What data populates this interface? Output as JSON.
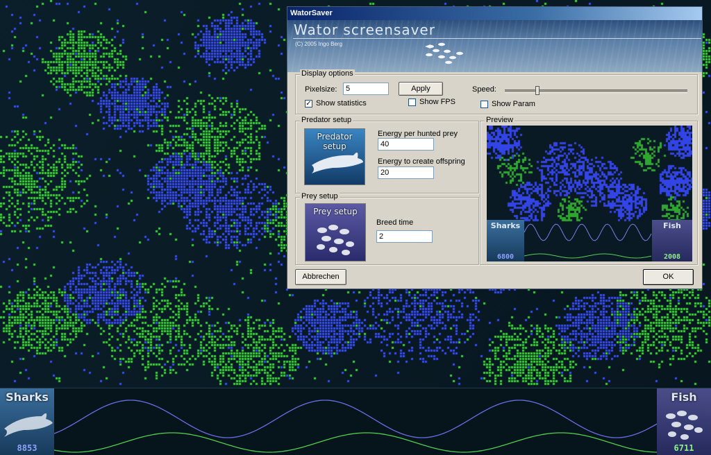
{
  "dialog": {
    "title": "WatorSaver",
    "banner_title": "Wator screensaver",
    "copyright": "(C) 2005 Ingo Berg",
    "display_options": {
      "legend": "Display options",
      "pixelsize_label": "Pixelsize:",
      "pixelsize_value": "5",
      "apply_label": "Apply",
      "speed_label": "Speed:",
      "speed_level": 0.17,
      "show_statistics_label": "Show statistics",
      "show_statistics_checked": true,
      "show_fps_label": "Show FPS",
      "show_fps_checked": false,
      "show_param_label": "Show Param",
      "show_param_checked": false
    },
    "predator_setup": {
      "legend": "Predator setup",
      "image_caption": "Predator setup",
      "energy_per_prey_label": "Energy per hunted prey",
      "energy_per_prey_value": "40",
      "energy_offspring_label": "Energy to create offspring",
      "energy_offspring_value": "20"
    },
    "prey_setup": {
      "legend": "Prey setup",
      "image_caption": "Prey setup",
      "breed_time_label": "Breed time",
      "breed_time_value": "2"
    },
    "preview": {
      "legend": "Preview",
      "sharks_label": "Sharks",
      "sharks_count": "6800",
      "fish_label": "Fish",
      "fish_count": "2008"
    },
    "cancel_label": "Abbrechen",
    "ok_label": "OK"
  },
  "stats": {
    "sharks_label": "Sharks",
    "sharks_count": "8853",
    "fish_label": "Fish",
    "fish_count": "6711"
  },
  "colors": {
    "shark": "#3a4ee8",
    "fish": "#3ecf3e",
    "ocean": "#0a1c26",
    "count_shark": "#8fa2ff",
    "count_fish": "#8ff08f"
  }
}
